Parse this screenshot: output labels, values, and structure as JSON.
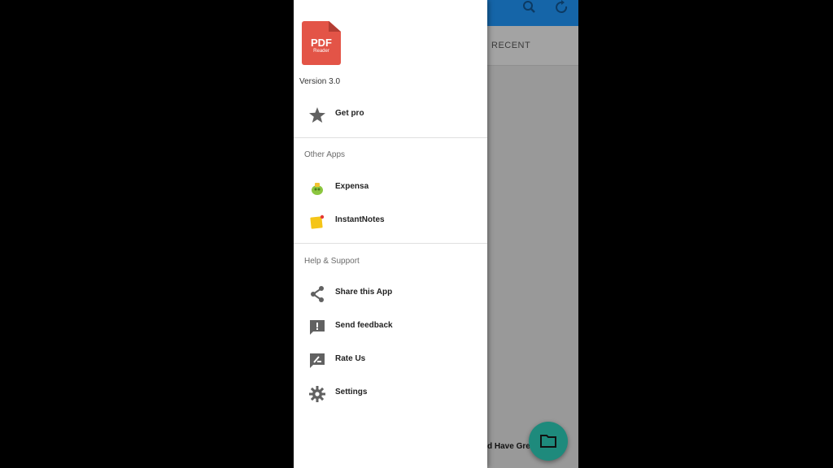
{
  "background_app": {
    "tab_recent": "RECENT",
    "card_title": "d Have Great",
    "search_icon": "search-icon",
    "refresh_icon": "refresh-icon",
    "fab_icon": "folder-icon",
    "colors": {
      "appbar": "#1565a8",
      "fab": "#1e8a7c"
    }
  },
  "drawer": {
    "logo": {
      "line1": "PDF",
      "line2": "Reader",
      "color": "#e35447"
    },
    "version": "Version 3.0",
    "items_top": [
      {
        "label": "Get pro",
        "icon": "star-icon"
      }
    ],
    "other_apps": {
      "header": "Other Apps",
      "items": [
        {
          "label": "Expensa",
          "icon": "expensa-app-icon"
        },
        {
          "label": "InstantNotes",
          "icon": "instantnotes-app-icon"
        }
      ]
    },
    "help_support": {
      "header": "Help & Support",
      "items": [
        {
          "label": "Share this App",
          "icon": "share-icon"
        },
        {
          "label": "Send feedback",
          "icon": "feedback-icon"
        },
        {
          "label": "Rate Us",
          "icon": "rate-icon"
        },
        {
          "label": "Settings",
          "icon": "gear-icon"
        }
      ]
    }
  }
}
